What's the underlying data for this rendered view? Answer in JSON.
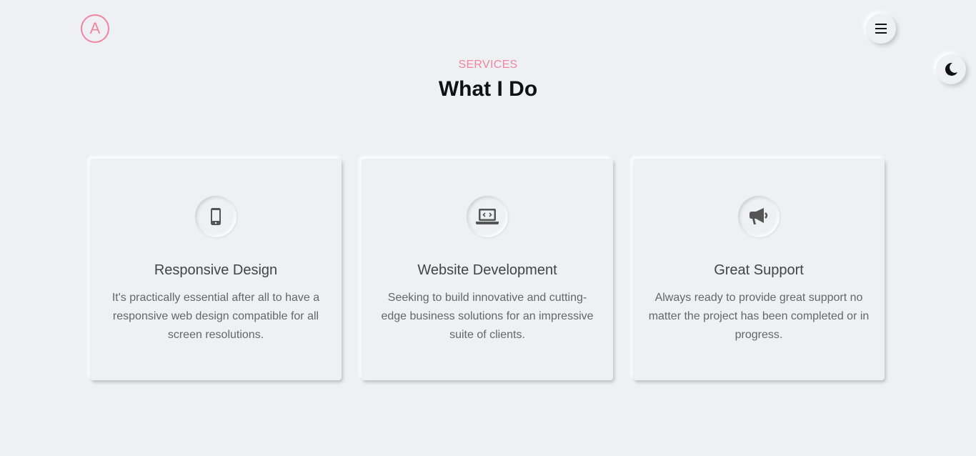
{
  "header": {
    "logo_letter": "A"
  },
  "section": {
    "eyebrow": "SERVICES",
    "title": "What I Do"
  },
  "services": [
    {
      "icon": "mobile-phone-icon",
      "title": "Responsive Design",
      "description": "It's practically essential after all to have a responsive web design compatible for all screen resolutions."
    },
    {
      "icon": "laptop-code-icon",
      "title": "Website Development",
      "description": "Seeking to build innovative and cutting-edge business solutions for an impressive suite of clients."
    },
    {
      "icon": "megaphone-icon",
      "title": "Great Support",
      "description": "Always ready to provide great support no matter the project has been completed or in progress."
    }
  ],
  "colors": {
    "accent": "#f0849f",
    "background": "#eff0f3",
    "heading": "#111111",
    "card_title": "#444444",
    "card_text": "#666666"
  }
}
